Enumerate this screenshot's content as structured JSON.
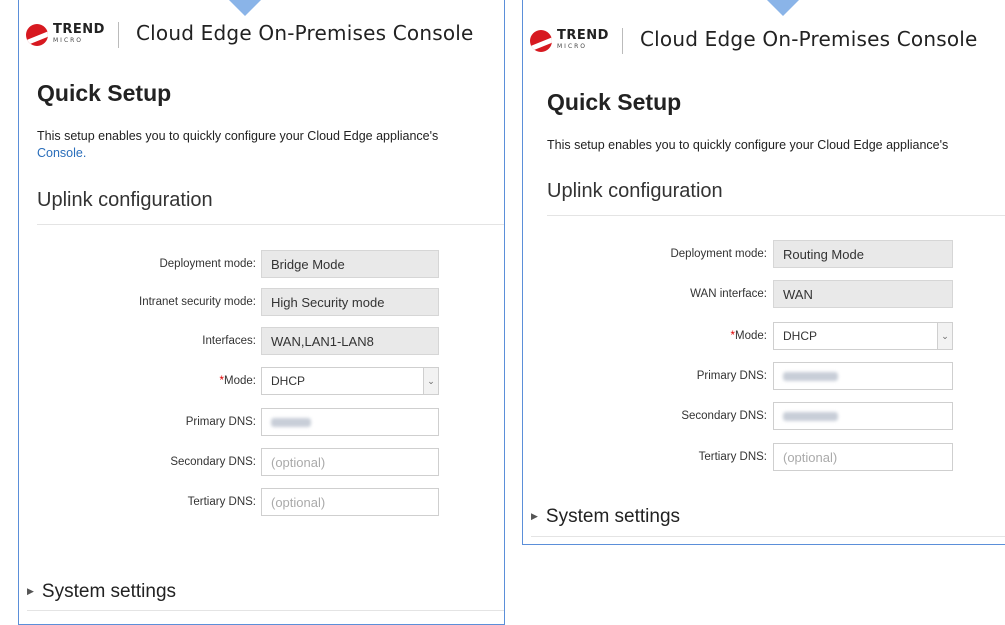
{
  "brand": {
    "logo_word": "TREND",
    "logo_sub": "MICRO",
    "console_title": "Cloud Edge On-Premises Console"
  },
  "left": {
    "page_title": "Quick Setup",
    "intro_text": "This setup enables you to quickly configure your Cloud Edge appliance's",
    "intro_link": "Console.",
    "section_title": "Uplink configuration",
    "fields": {
      "deployment_mode": {
        "label": "Deployment mode:",
        "value": "Bridge Mode"
      },
      "intranet_security_mode": {
        "label": "Intranet security mode:",
        "value": "High Security mode"
      },
      "interfaces": {
        "label": "Interfaces:",
        "value": "WAN,LAN1-LAN8"
      },
      "mode": {
        "label": "Mode:",
        "required_mark": "*",
        "value": "DHCP"
      },
      "primary_dns": {
        "label": "Primary DNS:"
      },
      "secondary_dns": {
        "label": "Secondary DNS:",
        "placeholder": "(optional)"
      },
      "tertiary_dns": {
        "label": "Tertiary DNS:",
        "placeholder": "(optional)"
      }
    },
    "system_settings": "System settings"
  },
  "right": {
    "page_title": "Quick Setup",
    "intro_text": "This setup enables you to quickly configure your Cloud Edge appliance's",
    "section_title": "Uplink configuration",
    "fields": {
      "deployment_mode": {
        "label": "Deployment mode:",
        "value": "Routing Mode"
      },
      "wan_interface": {
        "label": "WAN interface:",
        "value": "WAN"
      },
      "mode": {
        "label": "Mode:",
        "required_mark": "*",
        "value": "DHCP"
      },
      "primary_dns": {
        "label": "Primary DNS:"
      },
      "secondary_dns": {
        "label": "Secondary DNS:"
      },
      "tertiary_dns": {
        "label": "Tertiary DNS:",
        "placeholder": "(optional)"
      }
    },
    "system_settings": "System settings"
  },
  "colors": {
    "panel_border": "#5b8fd9",
    "arrow": "#8ab4e8",
    "brand_red": "#d71920",
    "link": "#2a6ebb",
    "required": "#dd0000"
  },
  "icons": {
    "logo": "trend-micro-ball-icon",
    "expand": "triangle-right-icon",
    "dropdown": "chevron-down-icon"
  }
}
